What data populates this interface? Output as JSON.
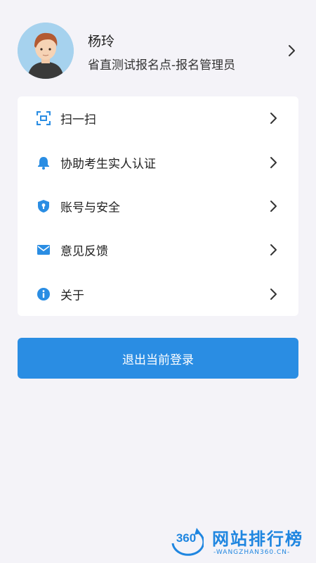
{
  "profile": {
    "name": "杨玲",
    "role": "省直测试报名点-报名管理员"
  },
  "menu": {
    "items": [
      {
        "label": "扫一扫",
        "icon": "scan-icon"
      },
      {
        "label": "协助考生实人认证",
        "icon": "bell-icon"
      },
      {
        "label": "账号与安全",
        "icon": "shield-icon"
      },
      {
        "label": "意见反馈",
        "icon": "mail-icon"
      },
      {
        "label": "关于",
        "icon": "info-icon"
      }
    ]
  },
  "logout": {
    "label": "退出当前登录"
  },
  "watermark": {
    "badge": "360",
    "title": "网站排行榜",
    "subtitle": "-WANGZHAN360.CN-"
  },
  "colors": {
    "accent": "#2a8de3",
    "background": "#f4f3f8",
    "card": "#ffffff"
  }
}
